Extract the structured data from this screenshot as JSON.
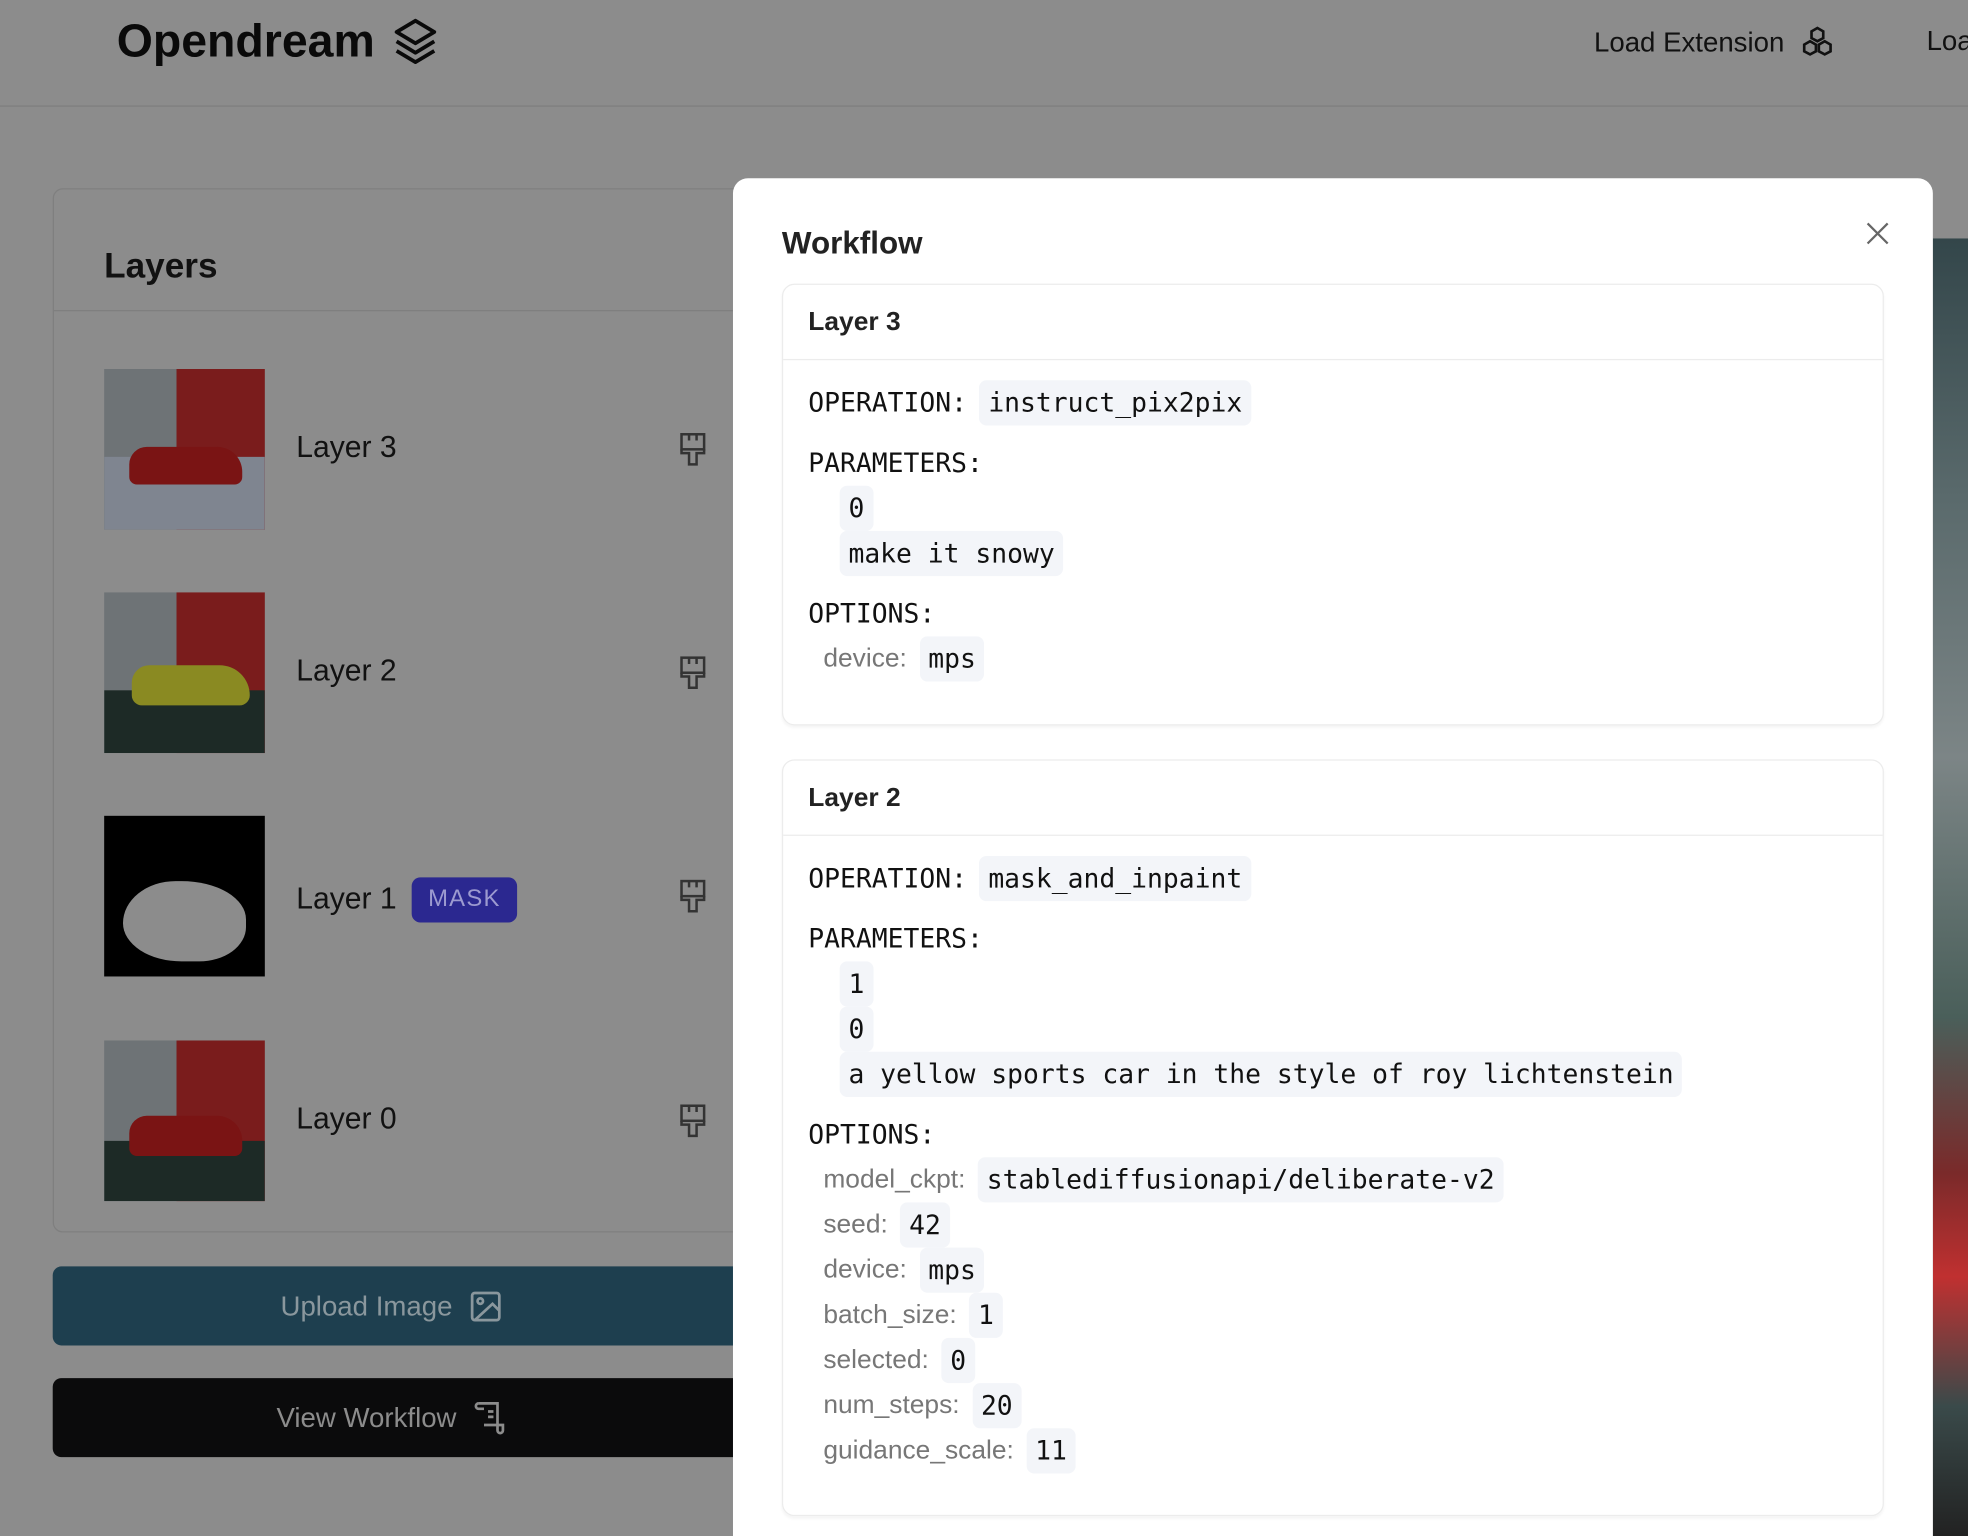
{
  "header": {
    "brand": "Opendream",
    "nav": [
      {
        "label": "Load Extension",
        "icon": "cubes-icon"
      },
      {
        "label": "Loa"
      }
    ]
  },
  "layers_panel": {
    "title": "Layers",
    "items": [
      {
        "name": "Layer 3",
        "badge": null,
        "thumb": "red-car-snowy"
      },
      {
        "name": "Layer 2",
        "badge": null,
        "thumb": "yellow-car"
      },
      {
        "name": "Layer 1",
        "badge": "MASK",
        "thumb": "mask"
      },
      {
        "name": "Layer 0",
        "badge": null,
        "thumb": "red-car"
      }
    ]
  },
  "buttons": {
    "upload": "Upload Image",
    "view_workflow": "View Workflow"
  },
  "colors": {
    "mask_badge": "#2b2890",
    "upload_button": "#1e3f4f",
    "view_workflow_button": "#0b0b0c"
  },
  "modal": {
    "title": "Workflow",
    "cards": [
      {
        "title": "Layer 3",
        "operation_label": "OPERATION:",
        "operation": "instruct_pix2pix",
        "parameters_label": "PARAMETERS:",
        "parameters": [
          "0",
          "make it snowy"
        ],
        "options_label": "OPTIONS:",
        "options": [
          {
            "key": "device:",
            "value": "mps"
          }
        ]
      },
      {
        "title": "Layer 2",
        "operation_label": "OPERATION:",
        "operation": "mask_and_inpaint",
        "parameters_label": "PARAMETERS:",
        "parameters": [
          "1",
          "0",
          "a yellow sports car in the style of roy lichtenstein"
        ],
        "options_label": "OPTIONS:",
        "options": [
          {
            "key": "model_ckpt:",
            "value": "stablediffusionapi/deliberate-v2"
          },
          {
            "key": "seed:",
            "value": "42"
          },
          {
            "key": "device:",
            "value": "mps"
          },
          {
            "key": "batch_size:",
            "value": "1"
          },
          {
            "key": "selected:",
            "value": "0"
          },
          {
            "key": "num_steps:",
            "value": "20"
          },
          {
            "key": "guidance_scale:",
            "value": "11"
          }
        ]
      }
    ]
  }
}
